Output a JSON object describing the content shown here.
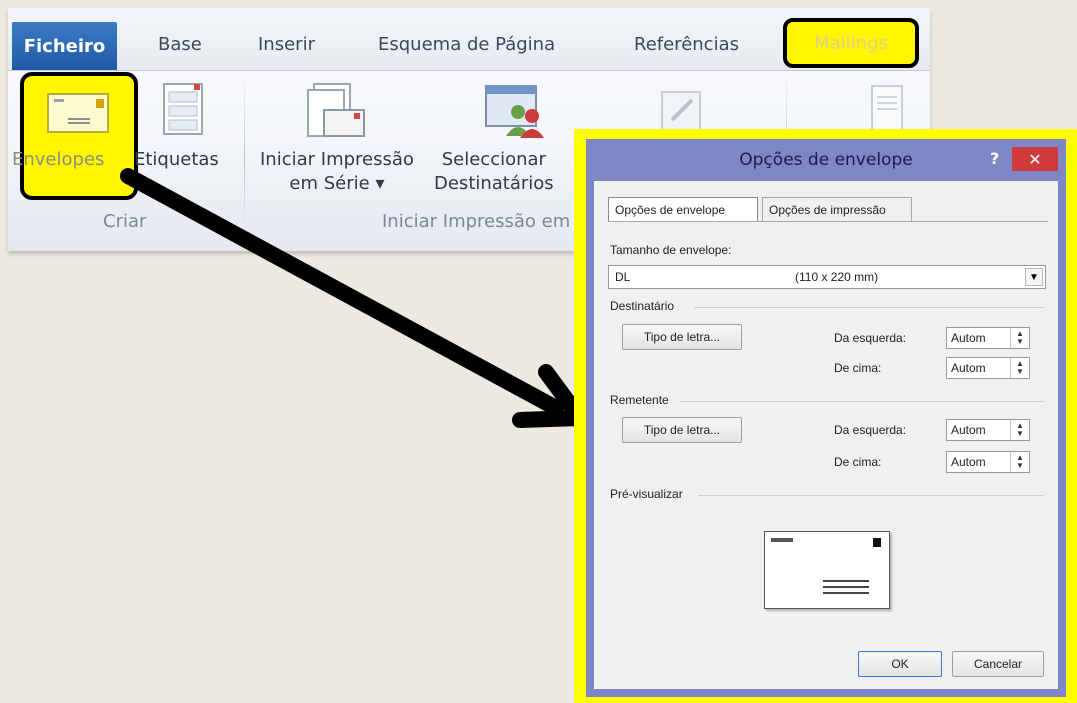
{
  "ribbon": {
    "tabs": {
      "file": "Ficheiro",
      "base": "Base",
      "insert": "Inserir",
      "layout": "Esquema de Página",
      "references": "Referências",
      "mailings": "Mailings"
    },
    "buttons": {
      "envelopes": "Envelopes",
      "labels": "Etiquetas",
      "start_merge_1": "Iniciar Impressão",
      "start_merge_2": "em Série",
      "select_1": "Seleccionar",
      "select_2": "Destinatários"
    },
    "groups": {
      "create": "Criar",
      "start_merge": "Iniciar Impressão em"
    }
  },
  "dialog": {
    "title": "Opções de envelope",
    "help": "?",
    "close": "✕",
    "tabs": [
      "Opções de envelope",
      "Opções de impressão"
    ],
    "size_label": "Tamanho de envelope:",
    "size_code": "DL",
    "size_dims": "(110 x 220 mm)",
    "recipient": {
      "section": "Destinatário",
      "font_button": "Tipo de letra...",
      "left_label": "Da esquerda:",
      "top_label": "De cima:",
      "left_value": "Autom",
      "top_value": "Autom"
    },
    "sender": {
      "section": "Remetente",
      "font_button": "Tipo de letra...",
      "left_label": "Da esquerda:",
      "top_label": "De cima:",
      "left_value": "Autom",
      "top_value": "Autom"
    },
    "preview_label": "Pré-visualizar",
    "ok": "OK",
    "cancel": "Cancelar"
  },
  "colors": {
    "highlight": "#fff600",
    "file_tab": "#2b66b4",
    "dialog_frame": "#7e86c5",
    "close_button": "#cf3a3a"
  }
}
